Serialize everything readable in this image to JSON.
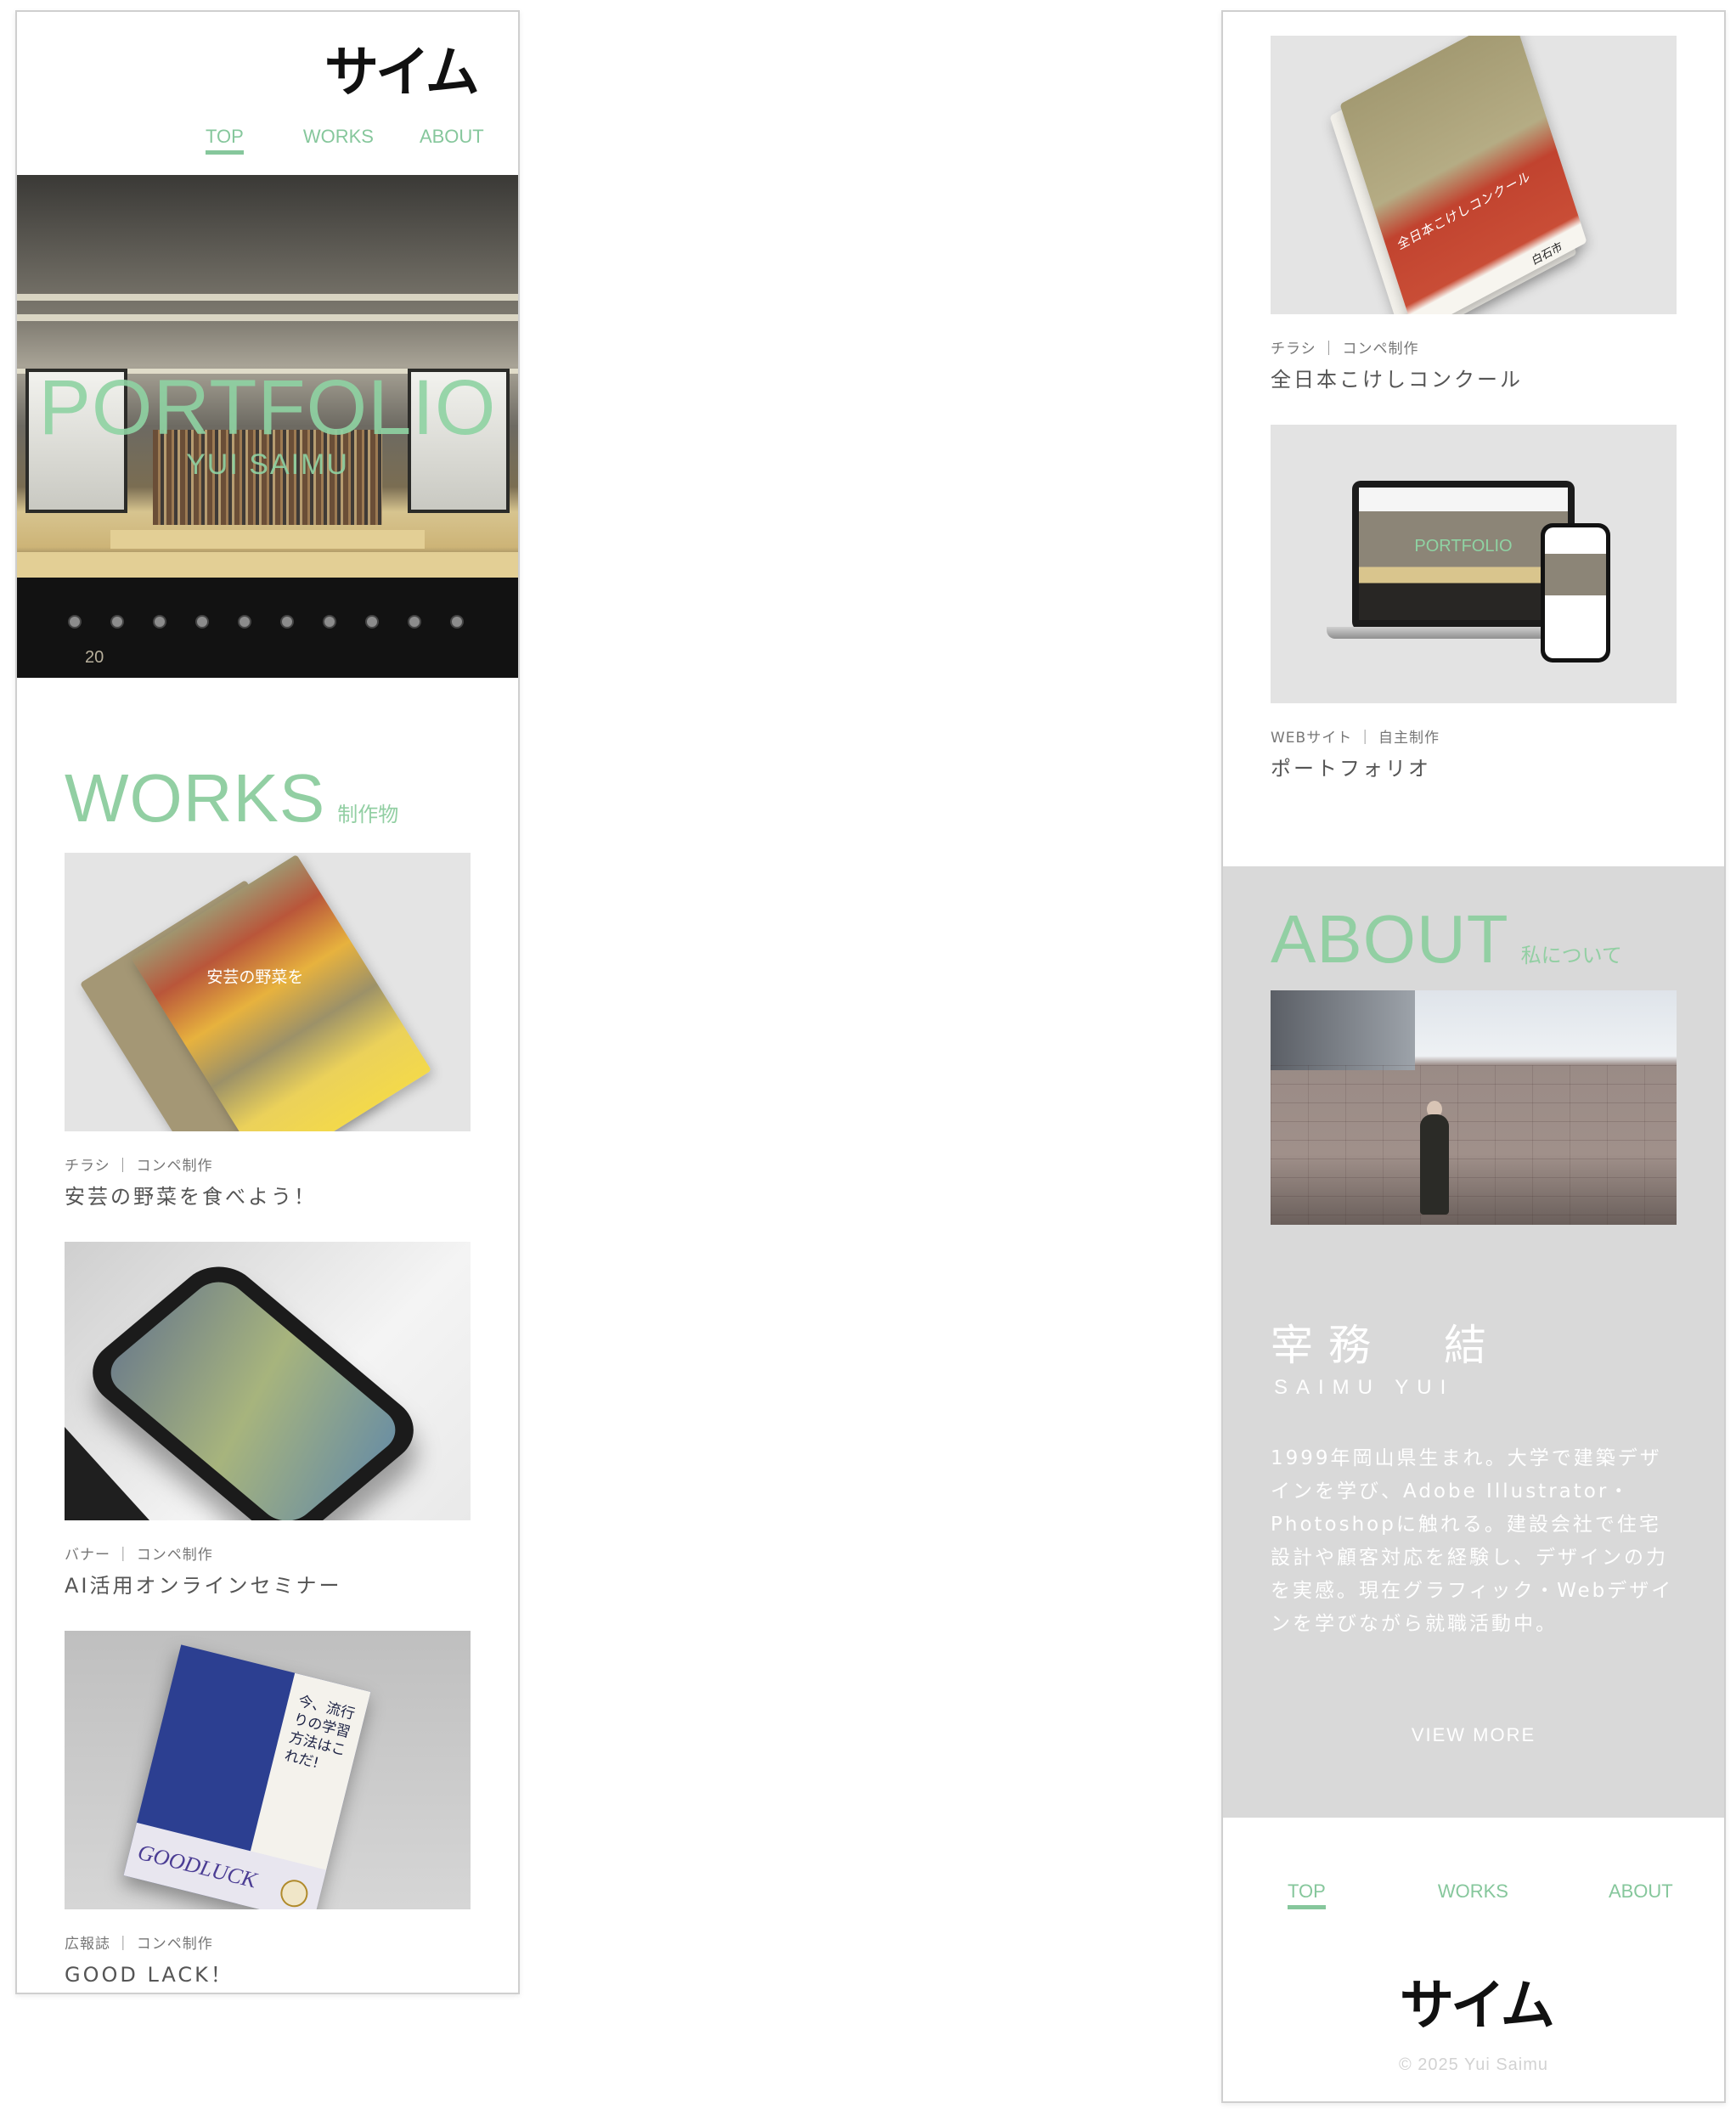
{
  "brand": {
    "logo_text": "サイム",
    "accent": "#86c79c"
  },
  "nav": {
    "items": [
      "TOP",
      "WORKS",
      "ABOUT"
    ],
    "active": "TOP"
  },
  "hero": {
    "title": "PORTFOLIO",
    "subtitle": "YUI SAIMU",
    "counter_number": "20"
  },
  "works": {
    "title": "WORKS",
    "subtitle": "制作物",
    "items": [
      {
        "meta": "チラシ ｜ コンペ制作",
        "title": "安芸の野菜を食べよう！",
        "thumb_text": "安芸の野菜を"
      },
      {
        "meta": "バナー ｜ コンペ制作",
        "title": "AI活用オンラインセミナー"
      },
      {
        "meta": "広報誌 ｜ コンペ制作",
        "title": "GOOD LACK！",
        "thumb_text": "今、流行りの学習方法はこれだ!",
        "thumb_label": "GOODLUCK"
      },
      {
        "meta": "チラシ ｜ コンペ制作",
        "title": "全日本こけしコンクール",
        "thumb_text": "全日本こけしコンクール",
        "thumb_city": "白石市"
      },
      {
        "meta": "WEBサイト ｜ 自主制作",
        "title": "ポートフォリオ",
        "thumb_text": "PORTFOLIO"
      }
    ]
  },
  "about": {
    "title": "ABOUT",
    "subtitle": "私について",
    "name_jp": "宰務　結",
    "name_en": "SAIMU YUI",
    "bio": "1999年岡山県生まれ。大学で建築デザインを学び、Adobe Illustrator・Photoshopに触れる。建設会社で住宅設計や顧客対応を経験し、デザインの力を実感。現在グラフィック・Webデザインを学びながら就職活動中。",
    "view_more": "VIEW MORE"
  },
  "footer": {
    "copyright": "© 2025 Yui Saimu"
  }
}
